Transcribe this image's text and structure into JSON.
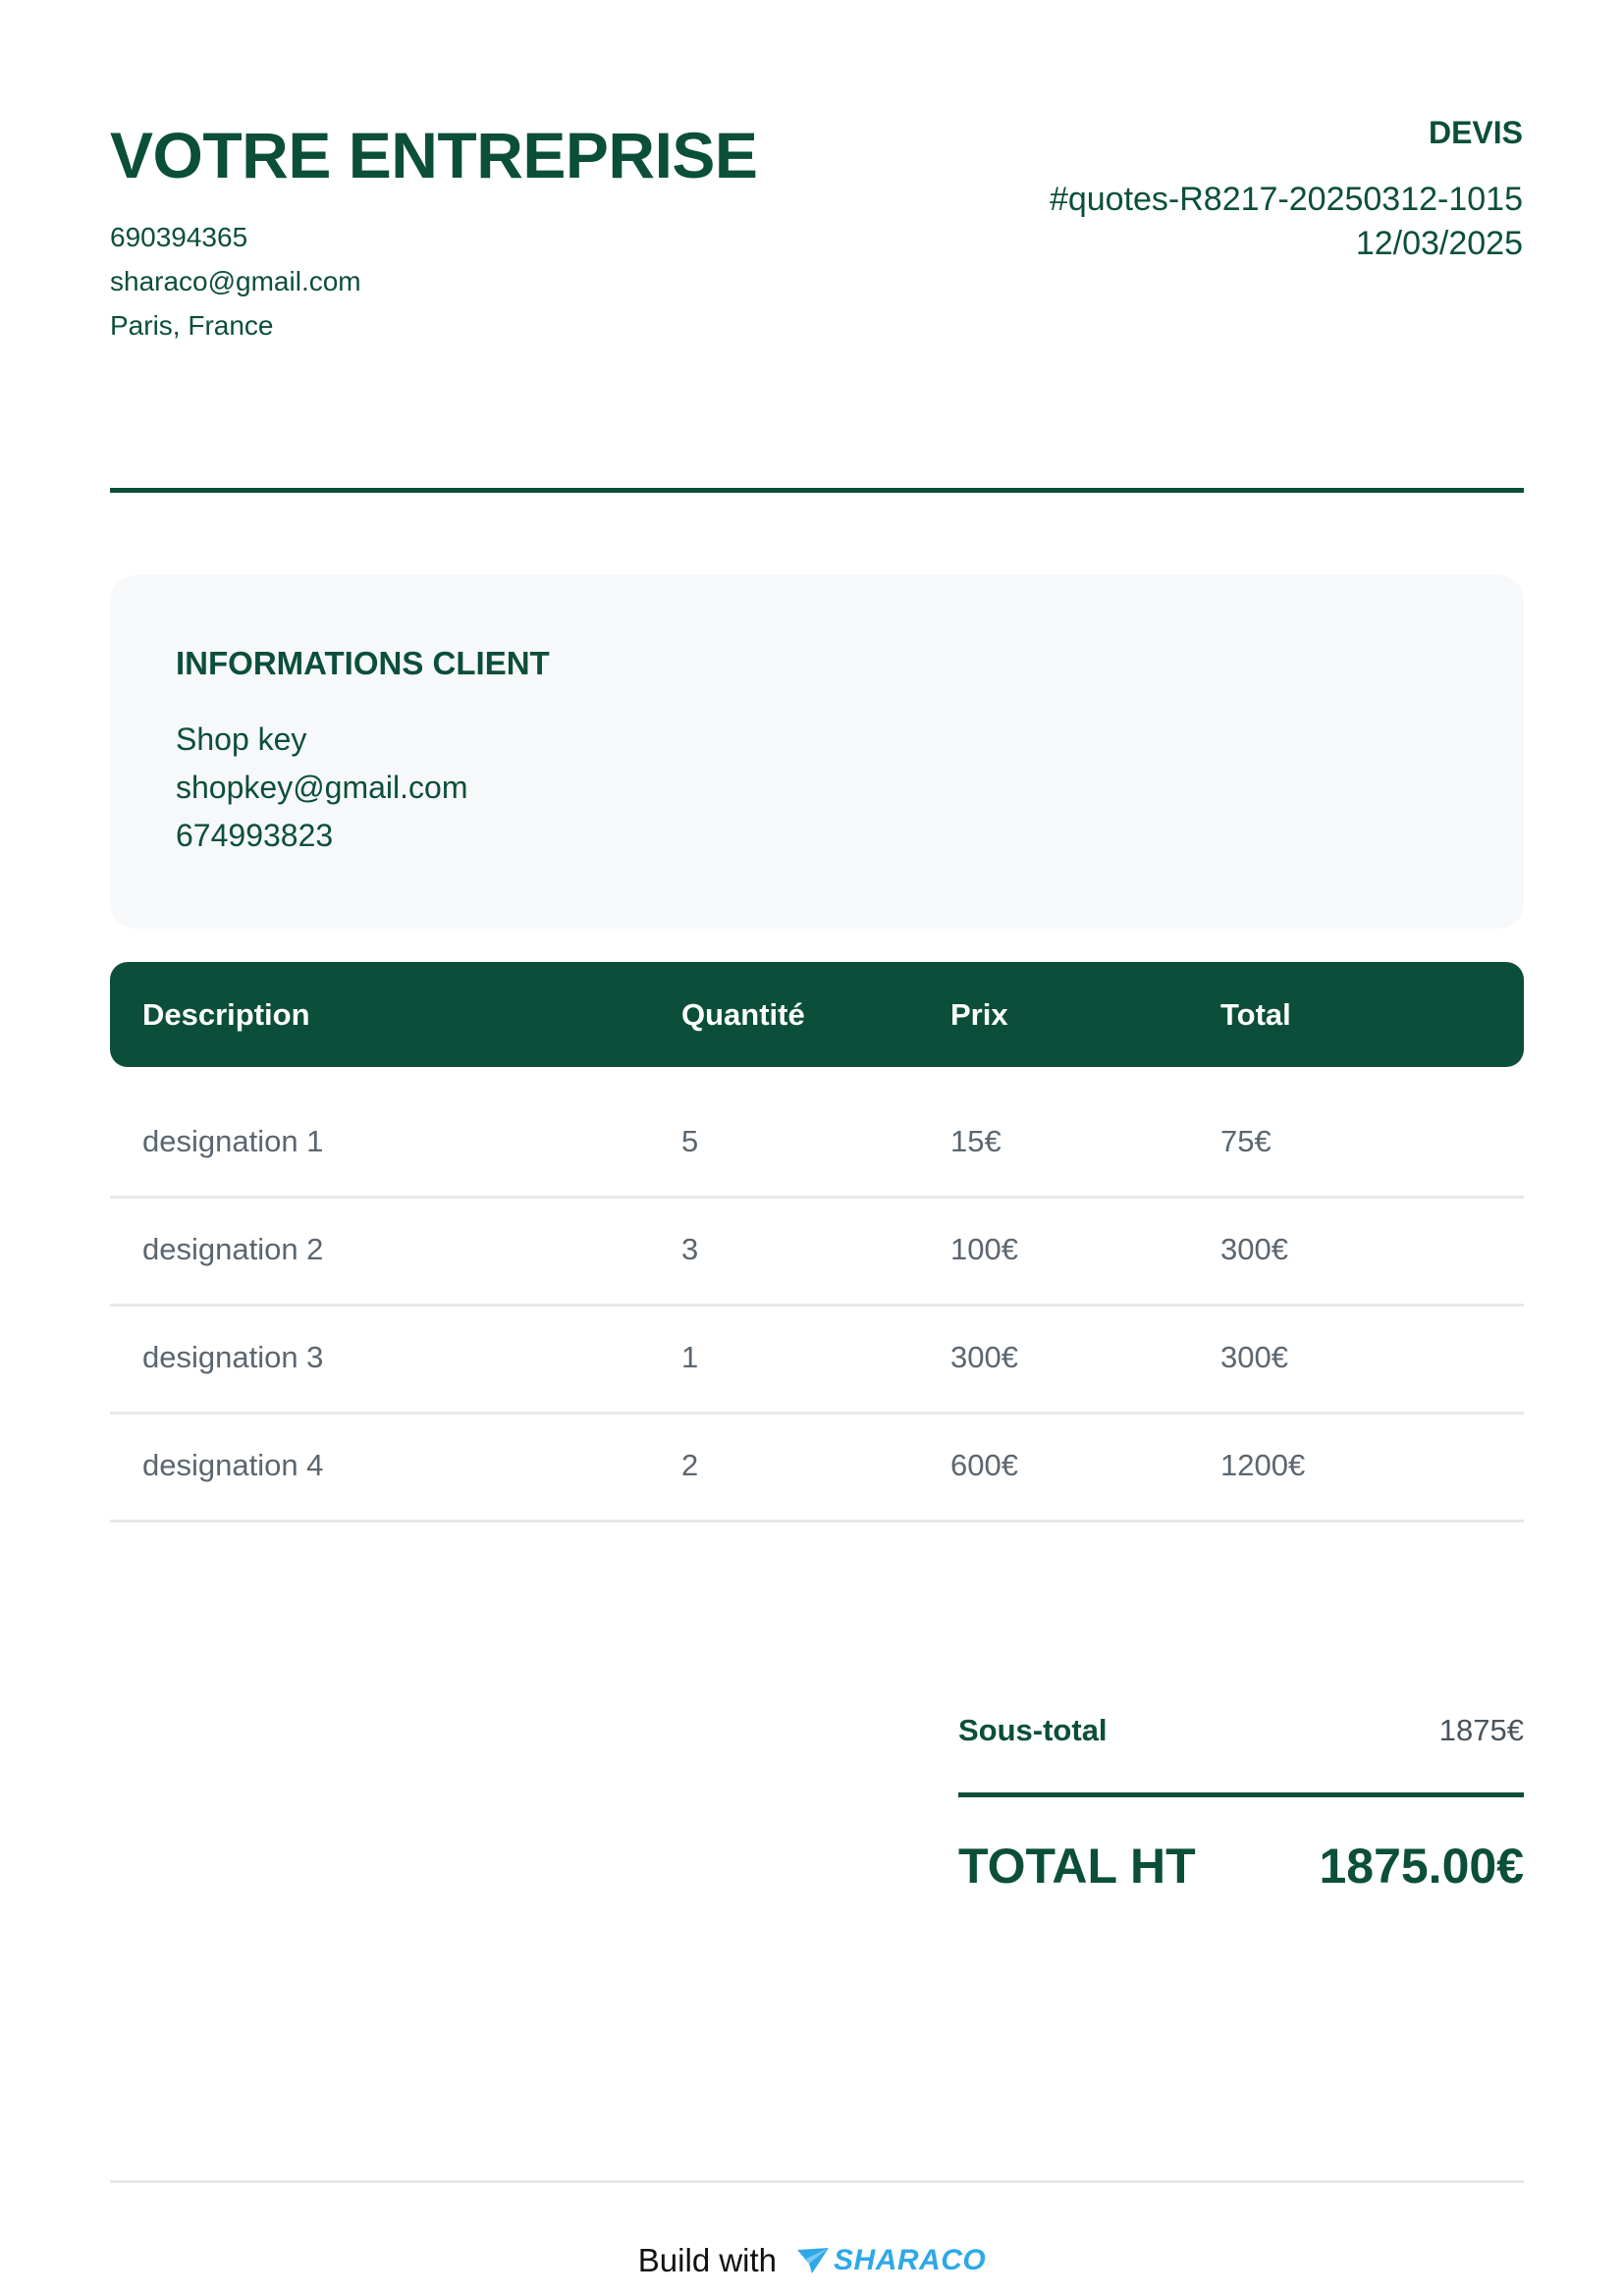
{
  "company": {
    "name": "VOTRE ENTREPRISE",
    "phone": "690394365",
    "email": "sharaco@gmail.com",
    "location": "Paris, France"
  },
  "document": {
    "type": "DEVIS",
    "number": "#quotes-R8217-20250312-1015",
    "date": "12/03/2025"
  },
  "client": {
    "title": "INFORMATIONS CLIENT",
    "name": "Shop key",
    "email": "shopkey@gmail.com",
    "phone": "674993823"
  },
  "table": {
    "headers": [
      "Description",
      "Quantité",
      "Prix",
      "Total"
    ],
    "rows": [
      [
        "designation 1",
        "5",
        "15€",
        "75€"
      ],
      [
        "designation 2",
        "3",
        "100€",
        "300€"
      ],
      [
        "designation 3",
        "1",
        "300€",
        "300€"
      ],
      [
        "designation 4",
        "2",
        "600€",
        "1200€"
      ]
    ]
  },
  "totals": {
    "subtotal_label": "Sous-total",
    "subtotal_value": "1875€",
    "total_label": "TOTAL HT",
    "total_value": "1875.00€"
  },
  "footer": {
    "text": "Build with",
    "brand": "SHARACO",
    "brand_icon": "paper-plane-icon",
    "brand_color": "#2fa8e8"
  },
  "colors": {
    "primary": "#0b4f3a",
    "client_box_bg": "#f7f8fa",
    "row_divider": "#e5e8eb"
  }
}
